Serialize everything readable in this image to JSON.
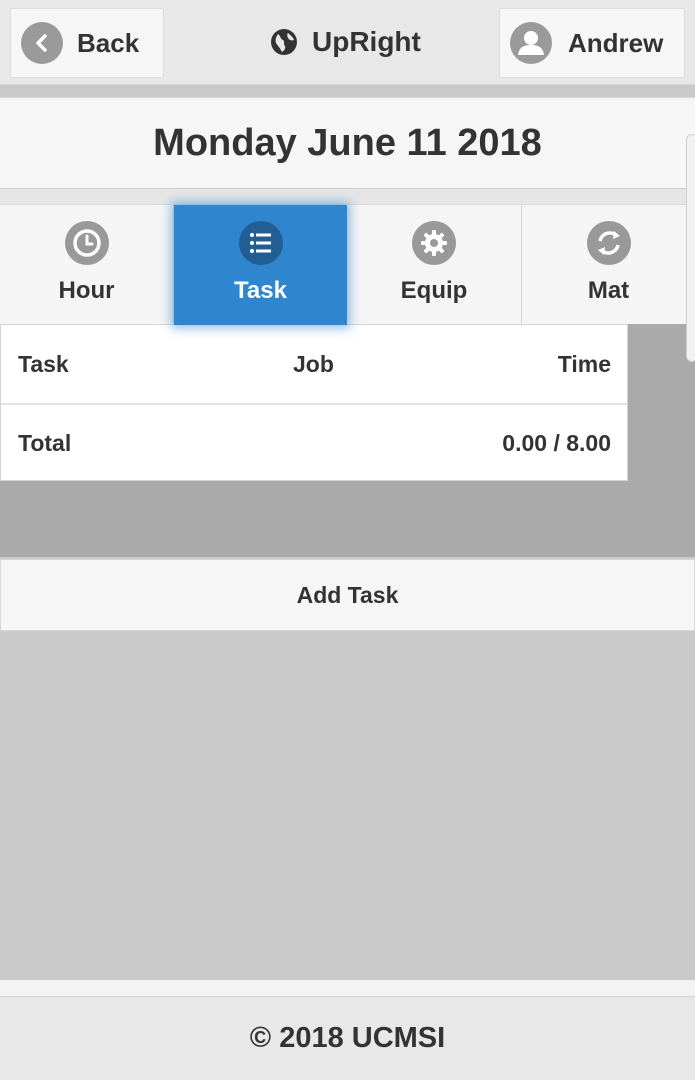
{
  "header": {
    "back_label": "Back",
    "brand": "UpRight",
    "user_label": "Andrew"
  },
  "date_title": "Monday June 11 2018",
  "tabs": [
    {
      "label": "Hour",
      "icon": "clock-icon",
      "active": false
    },
    {
      "label": "Task",
      "icon": "list-icon",
      "active": true
    },
    {
      "label": "Equip",
      "icon": "gear-icon",
      "active": false
    },
    {
      "label": "Mat",
      "icon": "refresh-icon",
      "active": false
    }
  ],
  "table": {
    "columns": [
      "Task",
      "Job",
      "Time"
    ],
    "total_label": "Total",
    "total_value": "0.00 / 8.00"
  },
  "add_task_label": "Add Task",
  "footer": "© 2018 UCMSI",
  "colors": {
    "accent": "#2f86cf",
    "header_bg": "#e8e8e8",
    "icon_gray": "#999999"
  }
}
